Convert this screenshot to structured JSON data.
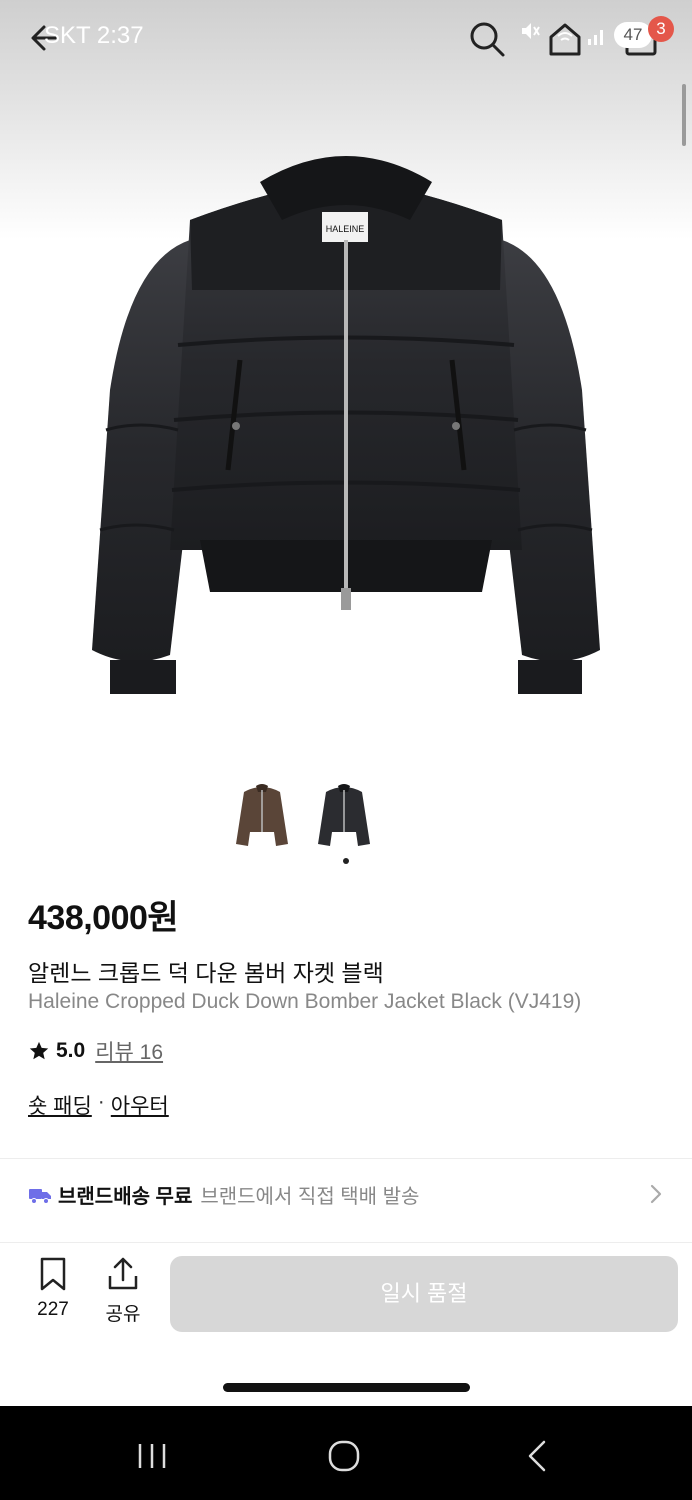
{
  "status_bar": {
    "time": "SKT 2:37",
    "battery": "47",
    "cart_badge": "3"
  },
  "header": {
    "back_icon": "arrow-left-icon",
    "search_icon": "search-icon",
    "home_icon": "home-icon",
    "cart_icon": "shopping-bag-icon"
  },
  "product": {
    "price": "438,000원",
    "name_ko": "알렌느 크롭드 덕 다운 봄버 자켓 블랙",
    "name_en": "Haleine Cropped Duck Down Bomber Jacket Black (VJ419)",
    "rating": "5.0",
    "review_label": "리뷰 16",
    "categories": [
      "숏 패딩",
      "아우터"
    ],
    "category_separator": "·",
    "thumbnails": [
      "brown-jacket-thumbnail",
      "black-jacket-thumbnail"
    ],
    "colors": {
      "jacket": "#2b2c30",
      "jacket_brown": "#5a4538"
    }
  },
  "delivery": {
    "title": "브랜드배송 무료",
    "description": "브랜드에서 직접 택배 발송",
    "accent": "#6e6ee8"
  },
  "actions": {
    "bookmark_count": "227",
    "share_label": "공유",
    "primary_label": "일시 품절"
  }
}
